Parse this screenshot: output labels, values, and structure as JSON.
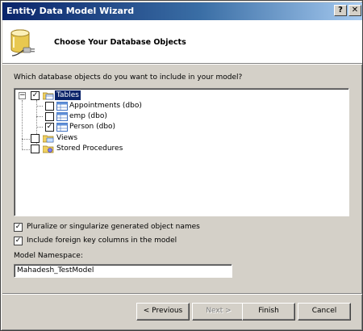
{
  "window": {
    "title": "Entity Data Model Wizard",
    "help_label": "?",
    "close_label": "✕"
  },
  "header": {
    "title": "Choose Your Database Objects",
    "icon": "database-plug-icon"
  },
  "question": "Which database objects do you want to include in your model?",
  "tree": {
    "tables": {
      "label": "Tables",
      "checked": true,
      "expanded": true,
      "expander": "−"
    },
    "children": [
      {
        "label": "Appointments (dbo)",
        "checked": false
      },
      {
        "label": "emp (dbo)",
        "checked": false
      },
      {
        "label": "Person (dbo)",
        "checked": true
      }
    ],
    "views": {
      "label": "Views",
      "checked": false
    },
    "procedures": {
      "label": "Stored Procedures",
      "checked": false
    }
  },
  "options": {
    "pluralize": {
      "label": "Pluralize or singularize generated object names",
      "checked": true
    },
    "foreign_keys": {
      "label": "Include foreign key columns in the model",
      "checked": true
    }
  },
  "namespace": {
    "label": "Model Namespace:",
    "value": "Mahadesh_TestModel"
  },
  "buttons": {
    "previous": "< Previous",
    "next": "Next >",
    "finish": "Finish",
    "cancel": "Cancel"
  },
  "check_mark": "✓",
  "colors": {
    "title_start": "#0a246a",
    "title_end": "#a6caf0",
    "face": "#d4d0c8",
    "selection": "#0a246a"
  }
}
